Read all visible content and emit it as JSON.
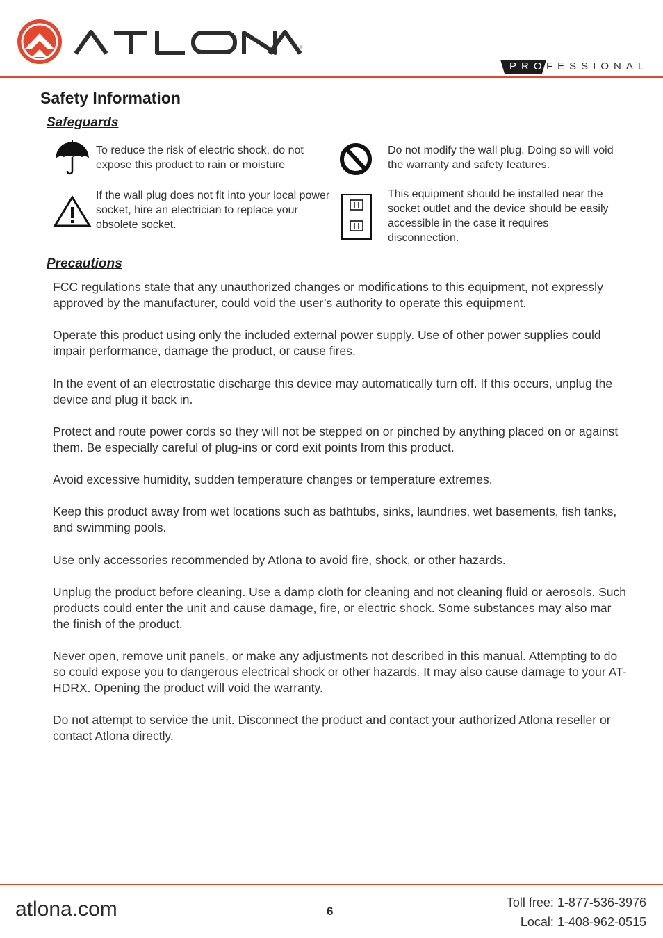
{
  "header": {
    "brand": "ATLONA",
    "registered_mark": "®",
    "badge_prefix": "PRO",
    "badge_suffix": "FESSIONAL",
    "accent_color": "#e4472e"
  },
  "page_title": "Safety Information",
  "safeguards": {
    "heading": "Safeguards",
    "items": [
      {
        "icon": "umbrella-icon",
        "text": "To reduce the risk of electric shock, do not expose this product to rain or moisture"
      },
      {
        "icon": "prohibited-icon",
        "text": "Do not modify the wall plug. Doing so will void the warranty and safety features."
      },
      {
        "icon": "warning-triangle-icon",
        "text": "If the wall plug does not fit into your local power socket, hire an electrician to replace your obsolete socket."
      },
      {
        "icon": "wall-socket-icon",
        "text": "This equipment should be installed near the socket outlet and the device should be easily accessible in the case it requires disconnection."
      }
    ]
  },
  "precautions": {
    "heading": "Precautions",
    "paragraphs": [
      "FCC regulations state that any unauthorized changes or modifications to this equipment, not expressly approved by the manufacturer, could void the user’s authority to operate this equipment.",
      "Operate this product using only the included external power supply. Use of other power supplies could impair performance, damage the product, or cause fires.",
      "In the event of an electrostatic discharge this device may automatically turn off. If this occurs, unplug the device and plug it back in.",
      "Protect and route power cords so they will not be stepped on or pinched by anything placed on or against them. Be especially careful of plug-ins or cord exit points from this product.",
      "Avoid excessive humidity, sudden temperature changes or temperature extremes.",
      "Keep this product away from wet locations such as bathtubs, sinks, laundries, wet basements, fish tanks, and swimming pools.",
      "Use only accessories recommended by Atlona to avoid fire, shock, or other hazards.",
      "Unplug the product before cleaning. Use a damp cloth for cleaning and not cleaning fluid or aerosols. Such products could enter the unit and cause damage, fire, or electric shock. Some substances may also mar the finish of the product.",
      "Never open, remove unit panels, or make any adjustments not described in this manual. Attempting to do so could expose you to dangerous electrical shock or other hazards. It may also cause damage to your AT-HDRX. Opening the product will void the warranty.",
      "Do not attempt to service the unit. Disconnect the product and contact your authorized Atlona reseller or contact Atlona directly."
    ]
  },
  "footer": {
    "website": "atlona.com",
    "page_number": "6",
    "toll_free": "Toll free: 1-877-536-3976",
    "local": "Local: 1-408-962-0515"
  }
}
